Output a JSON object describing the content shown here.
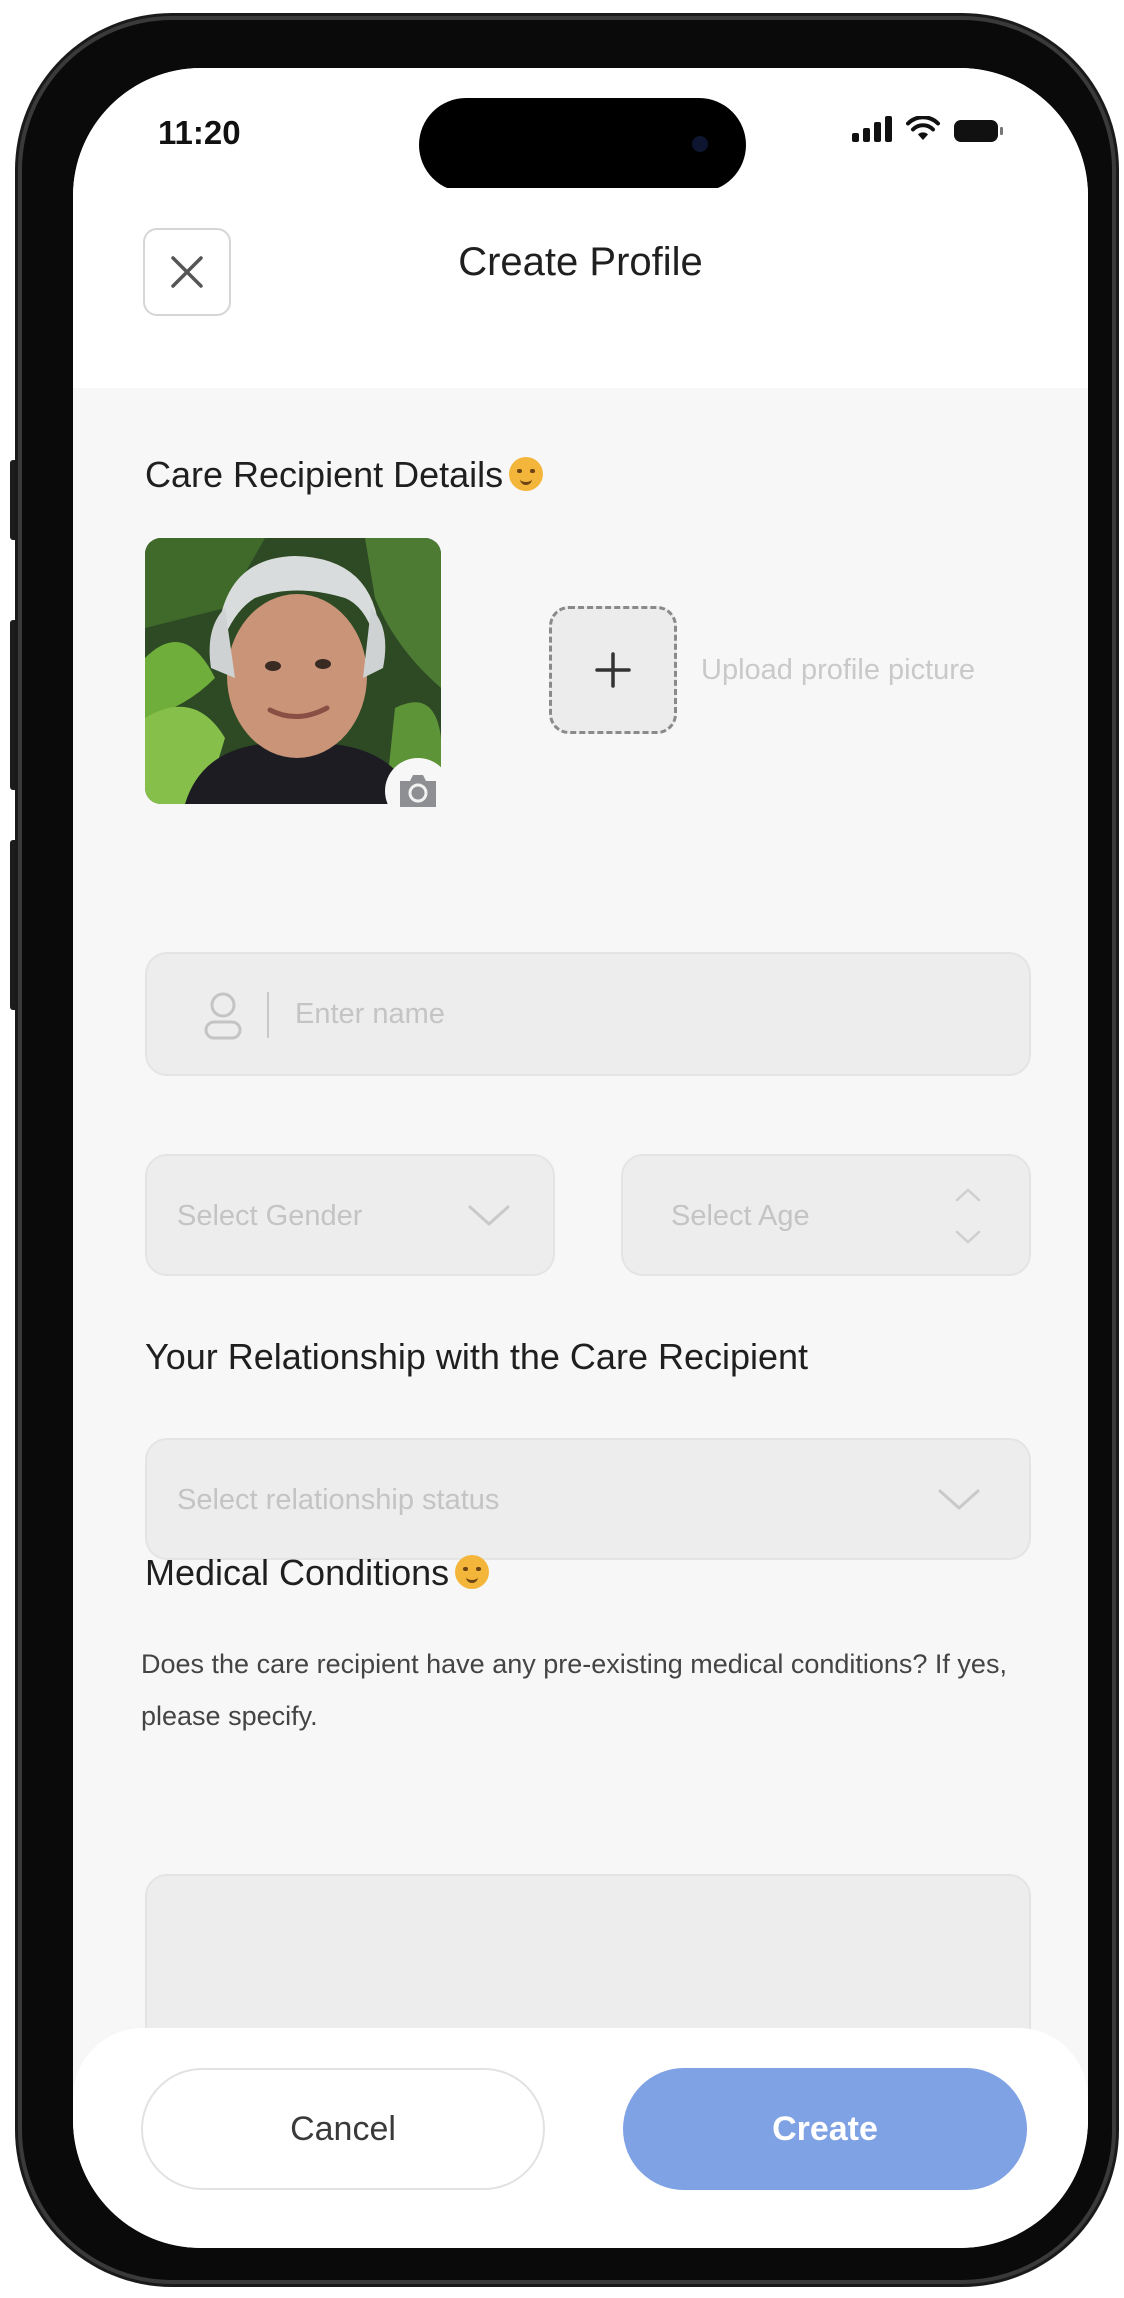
{
  "status_bar": {
    "time": "11:20"
  },
  "header": {
    "title": "Create Profile"
  },
  "care_recipient": {
    "heading": "Care Recipient Details",
    "upload_label": "Upload profile picture",
    "name_placeholder": "Enter name",
    "gender_placeholder": "Select Gender",
    "age_placeholder": "Select Age"
  },
  "relationship": {
    "heading": "Your Relationship with the Care Recipient",
    "placeholder": "Select relationship status"
  },
  "medical": {
    "heading": "Medical Conditions",
    "description": "Does the care recipient have any pre-existing medical conditions? If yes, please specify.",
    "textarea_value": ""
  },
  "footer": {
    "cancel_label": "Cancel",
    "create_label": "Create"
  },
  "colors": {
    "accent": "#7fa2e4",
    "background": "#f7f7f7",
    "field": "#ededed"
  }
}
